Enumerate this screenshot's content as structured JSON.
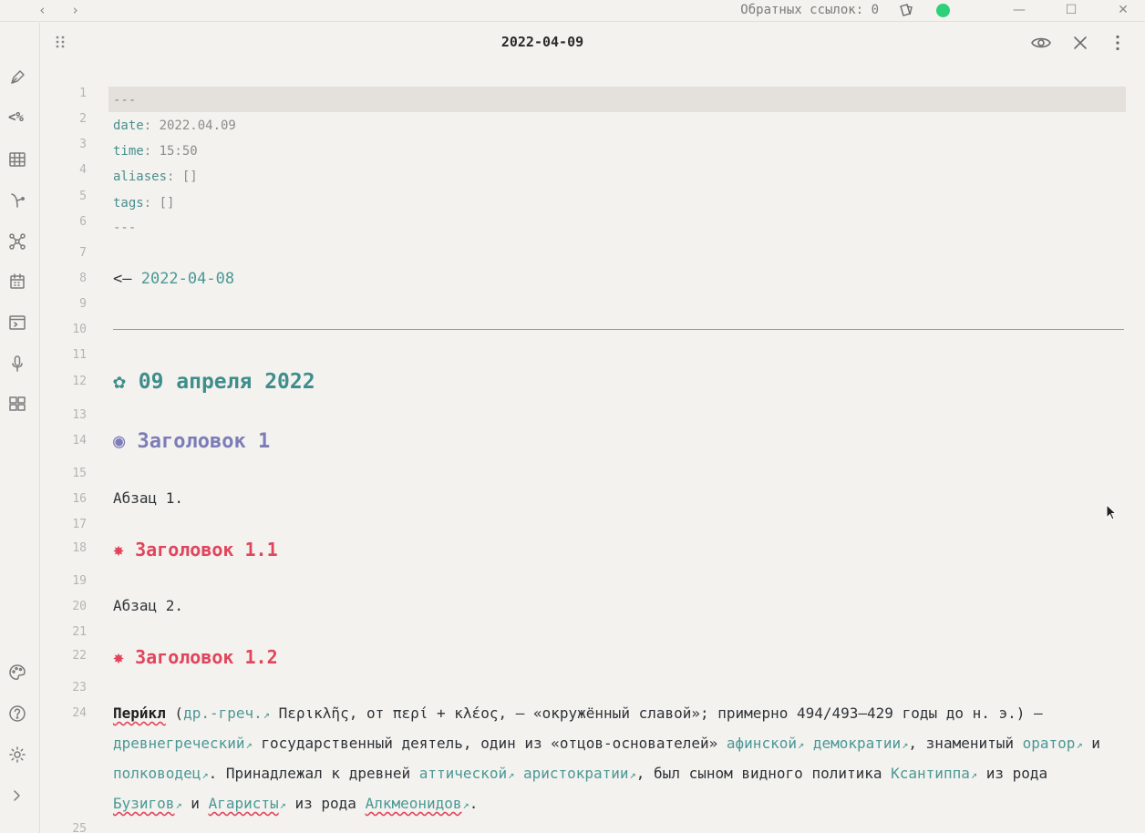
{
  "titlebar": {
    "back": "‹",
    "forward": "›",
    "backlinks": "Обратных ссылок: 0",
    "sync_color": "#2fd07a",
    "minimize": "—",
    "maximize": "☐",
    "close": "✕"
  },
  "ribbon": {
    "items": [
      "pen-icon",
      "templater-icon",
      "table-icon",
      "branch-icon",
      "graph-icon",
      "calendar-icon",
      "terminal-icon",
      "microphone-icon",
      "dashboard-icon",
      "palette-icon",
      "help-icon",
      "settings-icon",
      "expand-icon"
    ],
    "templater_text": "<%"
  },
  "header": {
    "title": "2022-04-09"
  },
  "line_numbers": [
    "1",
    "2",
    "3",
    "4",
    "5",
    "6",
    "7",
    "8",
    "9",
    "10",
    "11",
    "12",
    "13",
    "14",
    "15",
    "16",
    "17",
    "18",
    "19",
    "20",
    "21",
    "22",
    "23",
    "24",
    "25"
  ],
  "frontmatter": {
    "delim": "---",
    "date_key": "date",
    "date_val": "2022.04.09",
    "time_key": "time",
    "time_val": "15:50",
    "aliases_key": "aliases",
    "aliases_val": "[]",
    "tags_key": "tags",
    "tags_val": "[]"
  },
  "nav": {
    "arrow": "<— ",
    "prev_link": "2022-04-08"
  },
  "headings": {
    "date_icon": "✿",
    "date": "09 апреля 2022",
    "h1_icon": "◉",
    "h1": "Заголовок 1",
    "h2a_icon": "✸",
    "h2a": "Заголовок 1.1",
    "h2b_icon": "✸",
    "h2b": "Заголовок 1.2"
  },
  "paragraphs": {
    "p1": "Абзац 1.",
    "p2": "Абзац 2."
  },
  "pericles": {
    "name": "Пери́кл",
    "t1": " (",
    "l1": "др.-греч.",
    "t2": " Περικλῆς, от περί + κλέος, — «окружённый славой»; примерно 494/493—429 годы до н. э.) — ",
    "l2": "древнегреческий",
    "t3": " государственный деятель, один из «отцов-основателей» ",
    "l3": "афинской",
    "t4": " ",
    "l4": "демократии",
    "t5": ", знаменитый ",
    "l5": "оратор",
    "t6": " и ",
    "l6": "полководец",
    "t7": ". Принадлежал к древней ",
    "l7": "аттической",
    "t8": " ",
    "l8": "аристократии",
    "t9": ", был сыном видного политика ",
    "l9": "Ксантиппа",
    "t10": " из рода ",
    "l10": "Бузигов",
    "t11": " и ",
    "l11": "Агаристы",
    "t12": " из рода ",
    "l12": "Алкмеонидов",
    "t13": ".",
    "ext": "↗"
  }
}
